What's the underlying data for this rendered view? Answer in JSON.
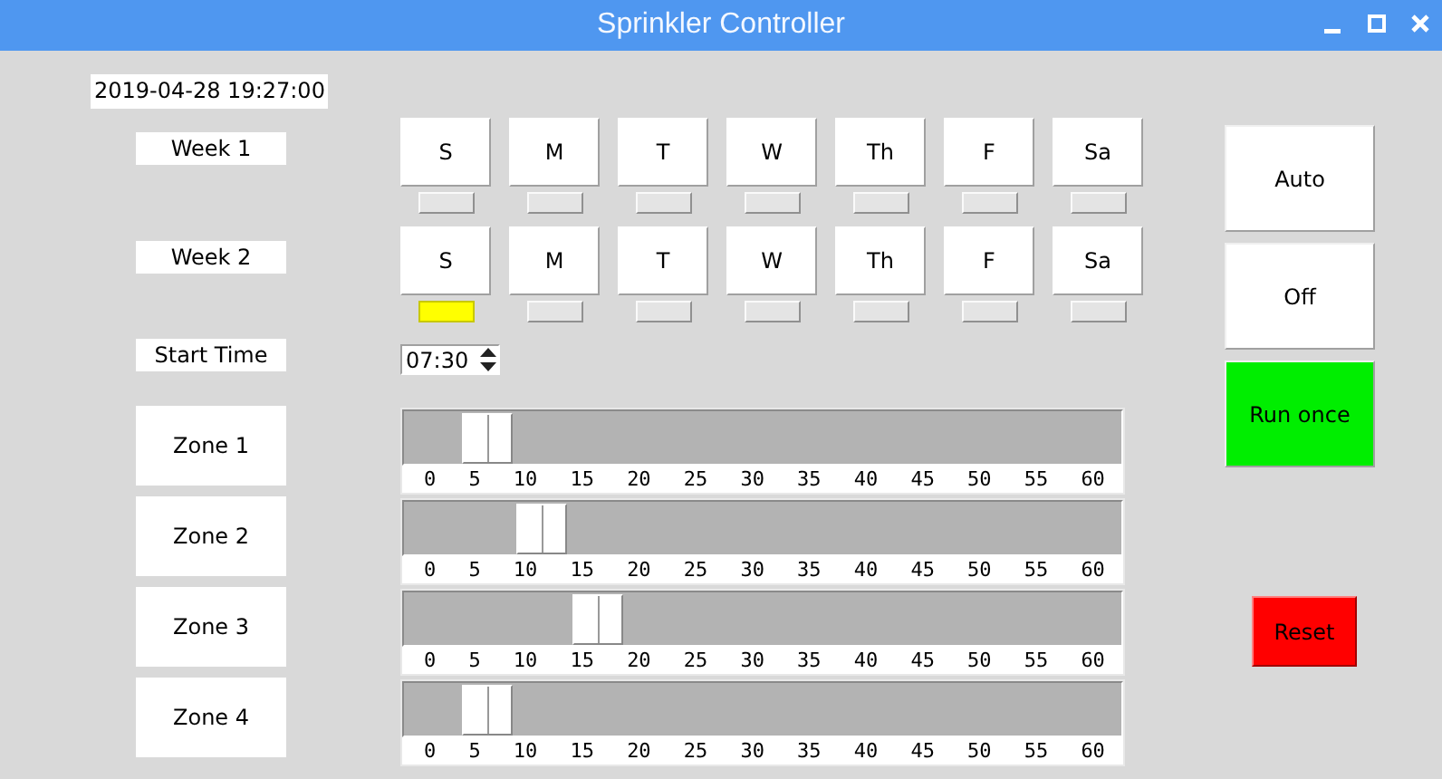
{
  "window": {
    "title": "Sprinkler Controller"
  },
  "clock": "2019-04-28 19:27:00",
  "weeks": [
    {
      "label": "Week 1",
      "days": [
        {
          "label": "S",
          "selected": false
        },
        {
          "label": "M",
          "selected": false
        },
        {
          "label": "T",
          "selected": false
        },
        {
          "label": "W",
          "selected": false
        },
        {
          "label": "Th",
          "selected": false
        },
        {
          "label": "F",
          "selected": false
        },
        {
          "label": "Sa",
          "selected": false
        }
      ]
    },
    {
      "label": "Week 2",
      "days": [
        {
          "label": "S",
          "selected": true
        },
        {
          "label": "M",
          "selected": false
        },
        {
          "label": "T",
          "selected": false
        },
        {
          "label": "W",
          "selected": false
        },
        {
          "label": "Th",
          "selected": false
        },
        {
          "label": "F",
          "selected": false
        },
        {
          "label": "Sa",
          "selected": false
        }
      ]
    }
  ],
  "start_time": {
    "label": "Start Time",
    "value": "07:30"
  },
  "zones": [
    {
      "label": "Zone 1",
      "level": 0.0833,
      "ticks": [
        "0",
        "5",
        "10",
        "15",
        "20",
        "25",
        "30",
        "35",
        "40",
        "45",
        "50",
        "55",
        "60"
      ]
    },
    {
      "label": "Zone 2",
      "level": 0.1667,
      "ticks": [
        "0",
        "5",
        "10",
        "15",
        "20",
        "25",
        "30",
        "35",
        "40",
        "45",
        "50",
        "55",
        "60"
      ]
    },
    {
      "label": "Zone 3",
      "level": 0.25,
      "ticks": [
        "0",
        "5",
        "10",
        "15",
        "20",
        "25",
        "30",
        "35",
        "40",
        "45",
        "50",
        "55",
        "60"
      ]
    },
    {
      "label": "Zone 4",
      "level": 0.0833,
      "ticks": [
        "0",
        "5",
        "10",
        "15",
        "20",
        "25",
        "30",
        "35",
        "40",
        "45",
        "50",
        "55",
        "60"
      ]
    }
  ],
  "mode_buttons": [
    {
      "label": "Auto",
      "color": "#ffffff"
    },
    {
      "label": "Off",
      "color": "#ffffff"
    },
    {
      "label": "Run once",
      "color": "#00ee00"
    }
  ],
  "reset_button": {
    "label": "Reset",
    "color": "#ff0000"
  }
}
